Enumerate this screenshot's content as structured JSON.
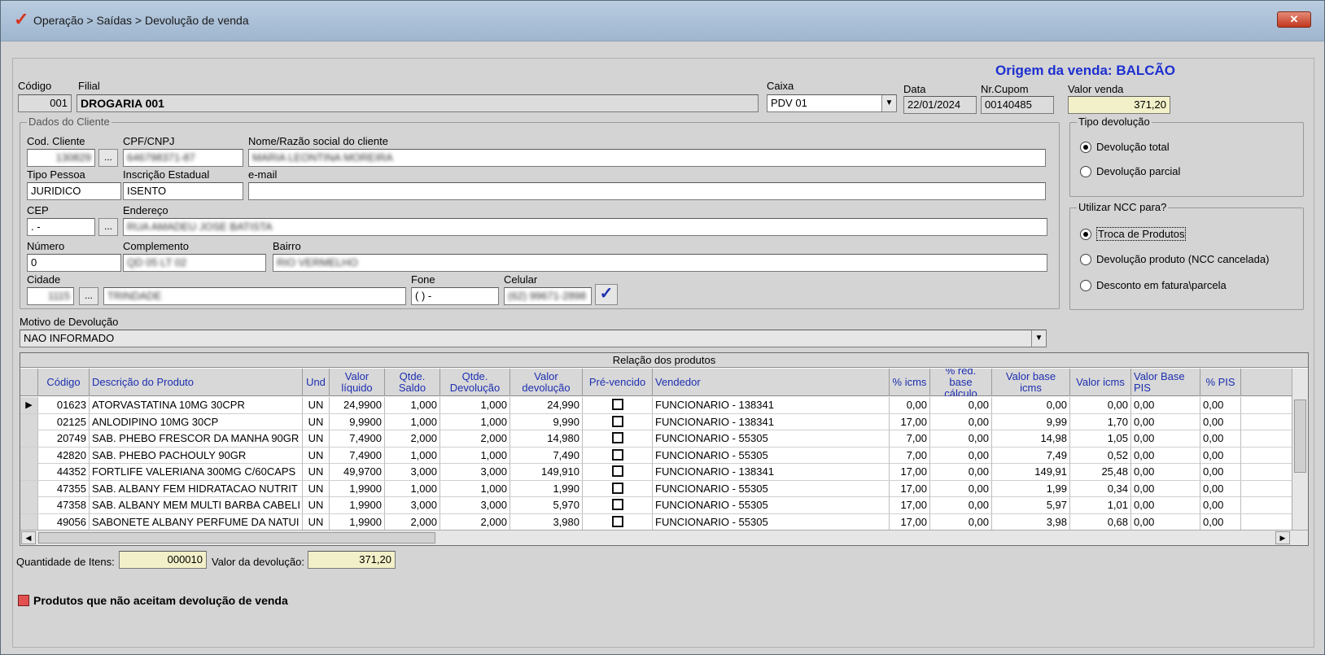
{
  "window": {
    "title": "Operação > Saídas > Devolução de venda",
    "close_symbol": "✕"
  },
  "origin": "Origem da venda: BALCÃO",
  "header": {
    "codigo_label": "Código",
    "codigo_value": "001",
    "filial_label": "Filial",
    "filial_value": "DROGARIA 001",
    "caixa_label": "Caixa",
    "caixa_value": "PDV 01",
    "data_label": "Data",
    "data_value": "22/01/2024",
    "cupom_label": "Nr.Cupom",
    "cupom_value": "00140485",
    "valor_venda_label": "Valor venda",
    "valor_venda_value": "371,20"
  },
  "cliente": {
    "group_title": "Dados do Cliente",
    "cod_label": "Cod. Cliente",
    "cod_value": "130829",
    "cpf_label": "CPF/CNPJ",
    "cpf_value": "646798371-87",
    "nome_label": "Nome/Razão social do cliente",
    "nome_value": "MARIA LEONTINA MOREIRA",
    "tipo_label": "Tipo Pessoa",
    "tipo_value": "JURIDICO",
    "ie_label": "Inscrição Estadual",
    "ie_value": "ISENTO",
    "email_label": "e-mail",
    "email_value": "",
    "cep_label": "CEP",
    "cep_value": ".   -",
    "endereco_label": "Endereço",
    "endereco_value": "RUA AMADEU JOSE BATISTA",
    "numero_label": "Número",
    "numero_value": "0",
    "complemento_label": "Complemento",
    "complemento_value": "QD 05 LT 02",
    "bairro_label": "Bairro",
    "bairro_value": "RIO VERMELHO",
    "cidade_label": "Cidade",
    "cidade_code": "1115",
    "cidade_name": "TRINDADE",
    "fone_label": "Fone",
    "fone_value": "(  )     -",
    "celular_label": "Celular",
    "celular_value": "(62) 99671-2898",
    "ellipsis": "..."
  },
  "tipo_devolucao": {
    "title": "Tipo devolução",
    "options": [
      "Devolução total",
      "Devolução parcial"
    ],
    "selected": 0
  },
  "ncc": {
    "title": "Utilizar NCC para?",
    "options": [
      "Troca de Produtos",
      "Devolução produto (NCC cancelada)",
      "Desconto em fatura\\parcela"
    ],
    "selected": 0
  },
  "motivo": {
    "label": "Motivo de Devolução",
    "value": "NAO INFORMADO"
  },
  "grid": {
    "caption": "Relação dos produtos",
    "columns": [
      "Código",
      "Descrição do Produto",
      "Und",
      "Valor líquido",
      "Qtde. Saldo",
      "Qtde. Devolução",
      "Valor devolução",
      "Pré-vencido",
      "Vendedor",
      "% icms",
      "% red. base cálculo",
      "Valor base icms",
      "Valor icms",
      "Valor Base PIS",
      "% PIS"
    ],
    "rows": [
      [
        "01623",
        "ATORVASTATINA 10MG 30CPR",
        "UN",
        "24,9900",
        "1,000",
        "1,000",
        "24,990",
        "",
        "FUNCIONARIO - 138341",
        "0,00",
        "0,00",
        "0,00",
        "0,00",
        "0,00",
        "0,00"
      ],
      [
        "02125",
        "ANLODIPINO 10MG  30CP",
        "UN",
        "9,9900",
        "1,000",
        "1,000",
        "9,990",
        "",
        "FUNCIONARIO - 138341",
        "17,00",
        "0,00",
        "9,99",
        "1,70",
        "0,00",
        "0,00"
      ],
      [
        "20749",
        "SAB. PHEBO FRESCOR DA MANHA 90GR",
        "UN",
        "7,4900",
        "2,000",
        "2,000",
        "14,980",
        "",
        "FUNCIONARIO - 55305",
        "7,00",
        "0,00",
        "14,98",
        "1,05",
        "0,00",
        "0,00"
      ],
      [
        "42820",
        "SAB. PHEBO PACHOULY 90GR",
        "UN",
        "7,4900",
        "1,000",
        "1,000",
        "7,490",
        "",
        "FUNCIONARIO - 55305",
        "7,00",
        "0,00",
        "7,49",
        "0,52",
        "0,00",
        "0,00"
      ],
      [
        "44352",
        "FORTLIFE VALERIANA  300MG C/60CAPS",
        "UN",
        "49,9700",
        "3,000",
        "3,000",
        "149,910",
        "",
        "FUNCIONARIO - 138341",
        "17,00",
        "0,00",
        "149,91",
        "25,48",
        "0,00",
        "0,00"
      ],
      [
        "47355",
        "SAB. ALBANY FEM HIDRATACAO NUTRIT",
        "UN",
        "1,9900",
        "1,000",
        "1,000",
        "1,990",
        "",
        "FUNCIONARIO - 55305",
        "17,00",
        "0,00",
        "1,99",
        "0,34",
        "0,00",
        "0,00"
      ],
      [
        "47358",
        "SAB. ALBANY MEM MULTI BARBA CABELI",
        "UN",
        "1,9900",
        "3,000",
        "3,000",
        "5,970",
        "",
        "FUNCIONARIO - 55305",
        "17,00",
        "0,00",
        "5,97",
        "1,01",
        "0,00",
        "0,00"
      ],
      [
        "49056",
        "SABONETE ALBANY PERFUME DA NATUI",
        "UN",
        "1,9900",
        "2,000",
        "2,000",
        "3,980",
        "",
        "FUNCIONARIO - 55305",
        "17,00",
        "0,00",
        "3,98",
        "0,68",
        "0,00",
        "0,00"
      ]
    ]
  },
  "footer": {
    "qtd_label": "Quantidade de Itens:",
    "qtd_value": "000010",
    "valor_label": "Valor da devolução:",
    "valor_value": "371,20",
    "legend_text": "Produtos que não aceitam devolução de venda",
    "legend_color": "#e35050"
  },
  "icons": {
    "title": "checkmark-logo-icon",
    "confirm": "checkmark-icon"
  }
}
